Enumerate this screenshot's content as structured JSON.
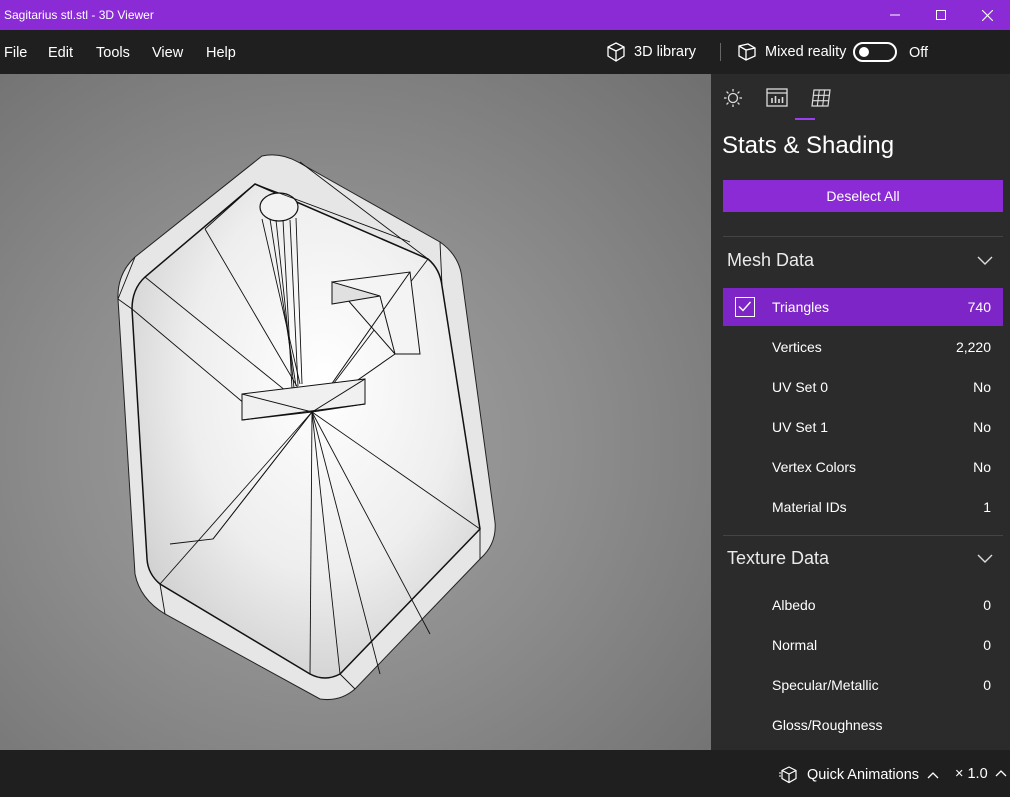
{
  "window": {
    "title": "Sagitarius stl.stl - 3D Viewer",
    "accent": "#8a2bd6"
  },
  "menu": {
    "items": [
      "File",
      "Edit",
      "Tools",
      "View",
      "Help"
    ]
  },
  "toolbar": {
    "library_label": "3D library",
    "mixed_reality_label": "Mixed reality",
    "toggle_state": "Off"
  },
  "panel": {
    "title": "Stats & Shading",
    "deselect_label": "Deselect All",
    "mesh": {
      "header": "Mesh Data",
      "rows": [
        {
          "label": "Triangles",
          "value": "740"
        },
        {
          "label": "Vertices",
          "value": "2,220"
        },
        {
          "label": "UV Set 0",
          "value": "No"
        },
        {
          "label": "UV Set 1",
          "value": "No"
        },
        {
          "label": "Vertex Colors",
          "value": "No"
        },
        {
          "label": "Material IDs",
          "value": "1"
        }
      ]
    },
    "texture": {
      "header": "Texture Data",
      "rows": [
        {
          "label": "Albedo",
          "value": "0"
        },
        {
          "label": "Normal",
          "value": "0"
        },
        {
          "label": "Specular/Metallic",
          "value": "0"
        },
        {
          "label": "Gloss/Roughness",
          "value": ""
        }
      ]
    }
  },
  "status": {
    "quick_animations_label": "Quick Animations",
    "speed_label": "× 1.0"
  }
}
